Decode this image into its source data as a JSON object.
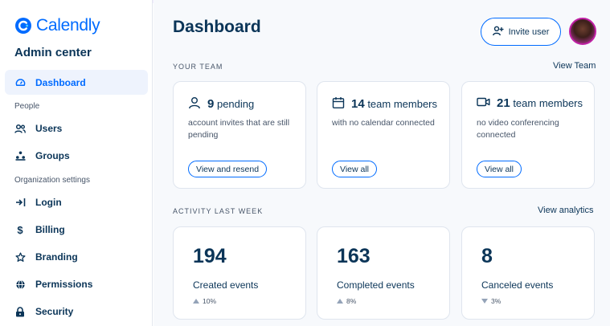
{
  "app": {
    "name": "Calendly",
    "accent": "#006bff",
    "text": "#0b3558"
  },
  "sidebar": {
    "title": "Admin center",
    "dashboard": {
      "label": "Dashboard",
      "icon": "dashboard-gauge-icon"
    },
    "people_label": "People",
    "users": {
      "label": "Users",
      "icon": "users-icon"
    },
    "groups": {
      "label": "Groups",
      "icon": "groups-icon"
    },
    "org_label": "Organization settings",
    "login": {
      "label": "Login",
      "icon": "login-arrow-icon"
    },
    "billing": {
      "label": "Billing",
      "icon": "dollar-icon"
    },
    "branding": {
      "label": "Branding",
      "icon": "star-icon"
    },
    "permissions": {
      "label": "Permissions",
      "icon": "globe-icon"
    },
    "security": {
      "label": "Security",
      "icon": "lock-icon"
    }
  },
  "header": {
    "title": "Dashboard",
    "invite_label": "Invite user"
  },
  "team": {
    "heading": "YOUR TEAM",
    "link": "View Team",
    "cards": [
      {
        "count": "9",
        "unit": "pending",
        "desc": "account invites that are still pending",
        "button": "View and resend",
        "icon": "person-icon"
      },
      {
        "count": "14",
        "unit": "team members",
        "desc": "with no calendar connected",
        "button": "View all",
        "icon": "calendar-icon"
      },
      {
        "count": "21",
        "unit": "team members",
        "desc": "no video conferencing connected",
        "button": "View all",
        "icon": "video-camera-icon"
      }
    ]
  },
  "activity": {
    "heading": "ACTIVITY LAST WEEK",
    "link": "View analytics",
    "cards": [
      {
        "value": "194",
        "label": "Created events",
        "trend": "10%",
        "direction": "up"
      },
      {
        "value": "163",
        "label": "Completed events",
        "trend": "8%",
        "direction": "up"
      },
      {
        "value": "8",
        "label": "Canceled events",
        "trend": "3%",
        "direction": "down"
      }
    ]
  }
}
